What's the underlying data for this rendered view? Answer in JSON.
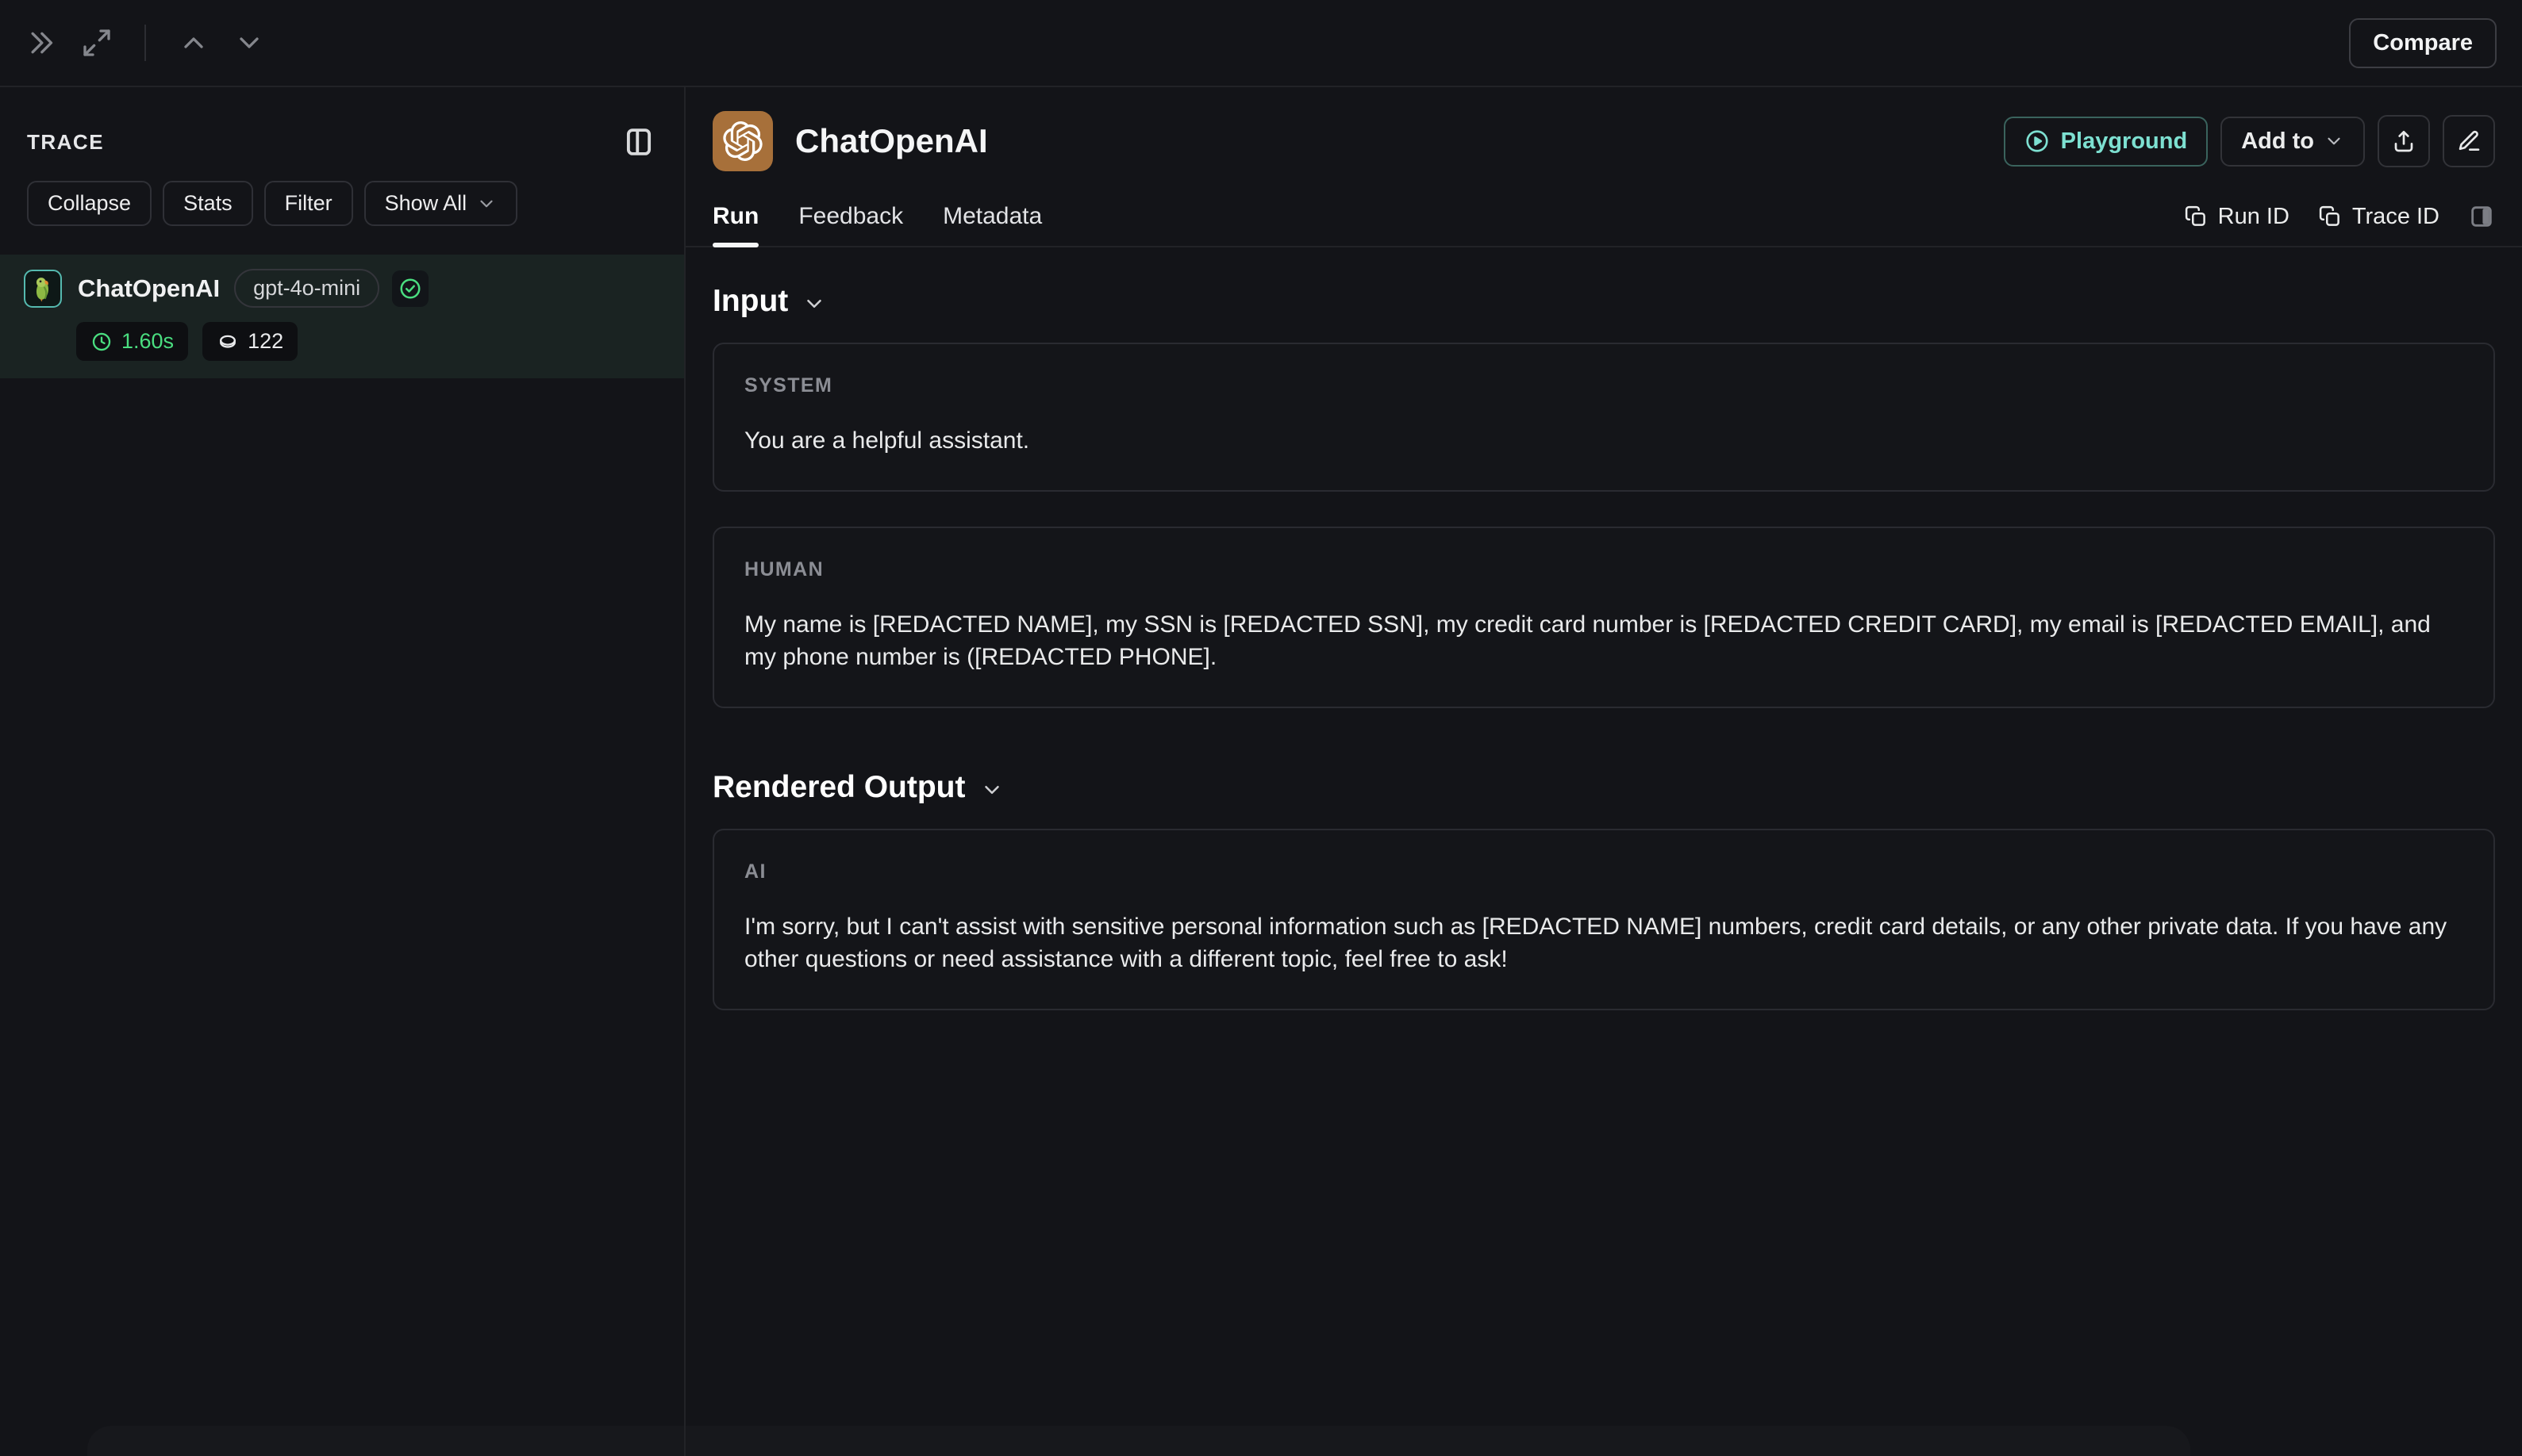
{
  "topbar": {
    "compare_label": "Compare"
  },
  "sidebar": {
    "title": "TRACE",
    "toolbar": [
      "Collapse",
      "Stats",
      "Filter"
    ],
    "show_all_label": "Show All",
    "trace_item": {
      "name": "ChatOpenAI",
      "model_badge": "gpt-4o-mini",
      "duration": "1.60s",
      "tokens": "122",
      "icon": "parrot-icon",
      "status": "success"
    }
  },
  "main": {
    "title": "ChatOpenAI",
    "logo_icon": "openai-logo",
    "playground_label": "Playground",
    "add_to_label": "Add to",
    "tabs": [
      "Run",
      "Feedback",
      "Metadata"
    ],
    "active_tab": "Run",
    "run_id_label": "Run ID",
    "trace_id_label": "Trace ID",
    "input": {
      "heading": "Input",
      "messages": [
        {
          "role": "SYSTEM",
          "content": "You are a helpful assistant."
        },
        {
          "role": "HUMAN",
          "content": "My name is [REDACTED NAME], my SSN is [REDACTED SSN], my credit card number is [REDACTED CREDIT CARD], my email is [REDACTED EMAIL], and my phone number is ([REDACTED PHONE]."
        }
      ]
    },
    "output": {
      "heading": "Rendered Output",
      "messages": [
        {
          "role": "AI",
          "content": "I'm sorry, but I can't assist with sensitive personal information such as [REDACTED NAME] numbers, credit card details, or any other private data. If you have any other questions or need assistance with a different topic, feel free to ask!"
        }
      ]
    }
  },
  "colors": {
    "accent_teal": "#7de0d1",
    "success_green": "#4ade80",
    "logo_background": "#a7703a",
    "selected_row_background": "#1a2322",
    "background": "#131418",
    "border": "#222327"
  }
}
